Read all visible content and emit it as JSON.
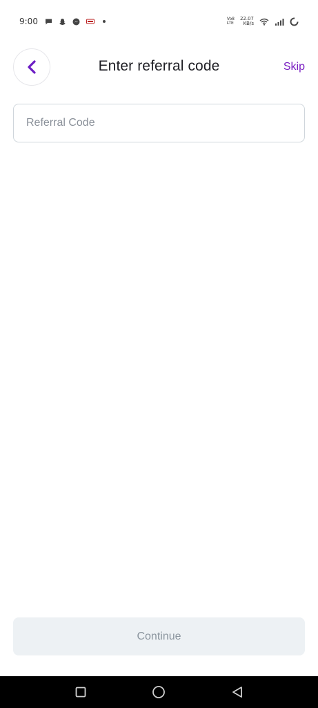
{
  "status_bar": {
    "time": "9:00",
    "network_speed_value": "22.07",
    "network_speed_unit": "KB/s",
    "volte_top": "Vo8",
    "volte_bottom": "LTE",
    "icons": [
      "chat-bubble-icon",
      "snapchat-icon",
      "messenger-icon",
      "app-icon",
      "dot-icon",
      "wifi-icon",
      "signal-icon",
      "battery-ring-icon"
    ]
  },
  "header": {
    "title": "Enter referral code",
    "skip_label": "Skip",
    "back_icon": "chevron-left-icon"
  },
  "form": {
    "referral_placeholder": "Referral Code",
    "referral_value": ""
  },
  "footer": {
    "continue_label": "Continue"
  },
  "nav_bar": {
    "icons": [
      "recents-square-icon",
      "home-circle-icon",
      "back-triangle-icon"
    ]
  },
  "colors": {
    "accent": "#7a1fc2",
    "title": "#1e1e24",
    "input_border": "#cfd6dc",
    "button_disabled_bg": "#edf1f4",
    "button_disabled_text": "#8b959e",
    "nav_bg": "#000000"
  }
}
